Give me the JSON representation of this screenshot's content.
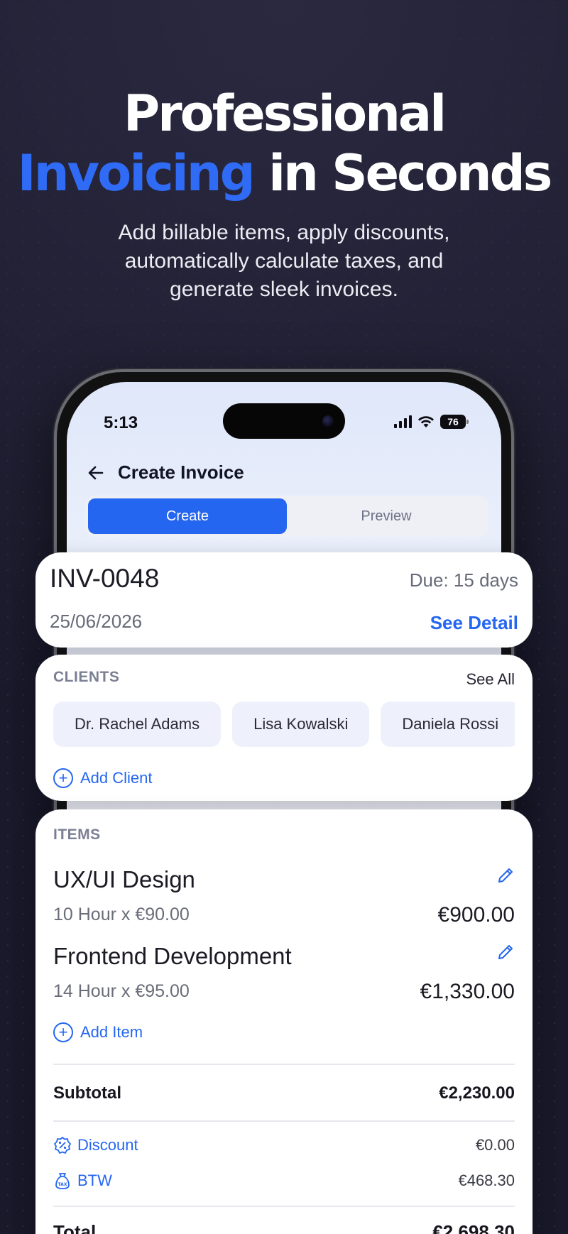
{
  "hero": {
    "title_line1": "Professional",
    "title_accent": "Invoicing",
    "title_rest": "in Seconds",
    "subtitle": "Add billable items, apply discounts, automatically calculate taxes, and generate sleek invoices."
  },
  "status_bar": {
    "time": "5:13",
    "battery": "76"
  },
  "app_bar": {
    "title": "Create Invoice"
  },
  "tabs": {
    "create": "Create",
    "preview": "Preview"
  },
  "invoice": {
    "number": "INV-0048",
    "due": "Due: 15 days",
    "date": "25/06/2026",
    "see_detail": "See Detail"
  },
  "clients": {
    "label": "CLIENTS",
    "see_all": "See All",
    "list": [
      "Dr. Rachel Adams",
      "Lisa Kowalski",
      "Daniela Rossi"
    ],
    "add_label": "Add Client"
  },
  "items": {
    "label": "ITEMS",
    "list": [
      {
        "name": "UX/UI Design",
        "qty": "10 Hour x €90.00",
        "price": "€900.00"
      },
      {
        "name": "Frontend Development",
        "qty": "14 Hour x €95.00",
        "price": "€1,330.00"
      }
    ],
    "add_label": "Add Item"
  },
  "summary": {
    "subtotal_label": "Subtotal",
    "subtotal": "€2,230.00",
    "discount_label": "Discount",
    "discount": "€0.00",
    "tax_label": "BTW",
    "tax": "€468.30",
    "total_label": "Total",
    "total": "€2,698.30"
  },
  "colors": {
    "accent": "#2566f0",
    "background": "#1b1a2c"
  },
  "icons": [
    "back-arrow-icon",
    "signal-icon",
    "wifi-icon",
    "battery-icon",
    "plus-circle-icon",
    "pencil-icon",
    "discount-badge-icon",
    "tax-bag-icon"
  ]
}
